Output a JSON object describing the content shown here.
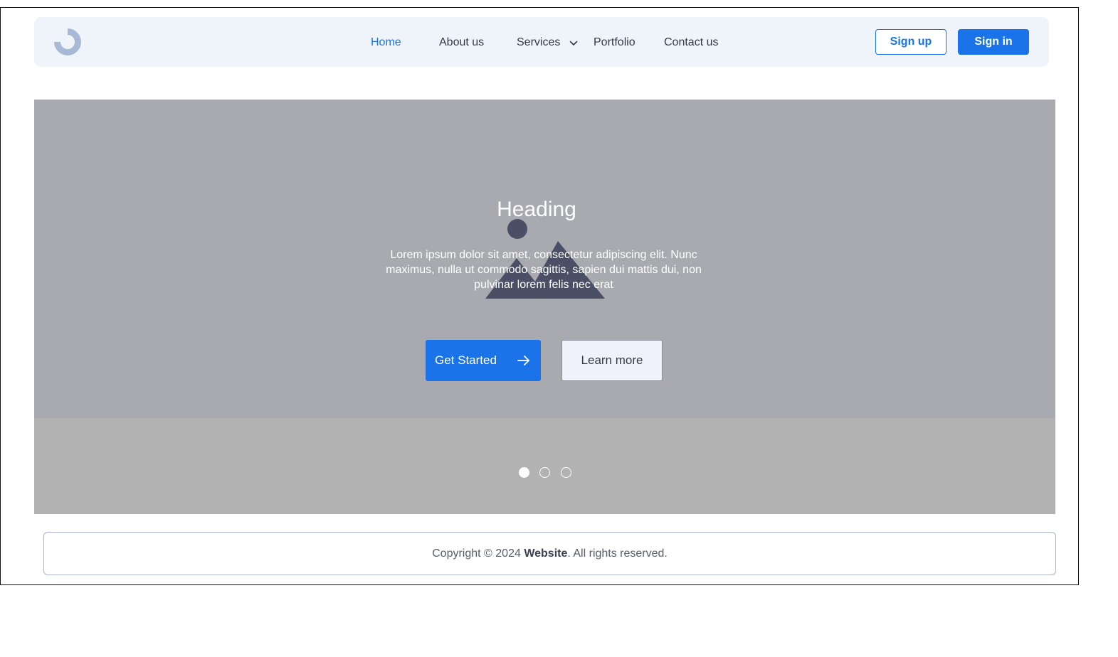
{
  "header": {
    "logo_icon": "logo-ring-icon",
    "nav_items": [
      {
        "label": "Home",
        "active": true
      },
      {
        "label": "About us",
        "active": false
      },
      {
        "label": "Services",
        "active": false,
        "has_dropdown": true
      },
      {
        "label": "Portfolio",
        "active": false
      },
      {
        "label": "Contact us",
        "active": false
      }
    ],
    "signup_label": "Sign up",
    "signin_label": "Sign in"
  },
  "hero": {
    "image_icon": "image-placeholder-icon",
    "heading": "Heading",
    "text": "Lorem ipsum dolor sit amet, consectetur adipiscing elit. Nunc maximus, nulla ut commodo sagittis, sapien dui mattis dui, non pulvinar lorem felis nec erat",
    "primary_button": "Get Started",
    "primary_button_icon": "arrow-right-icon",
    "secondary_button": "Learn more",
    "slides_total": 3,
    "active_slide": 1
  },
  "footer": {
    "prefix": "Copyright © 2024 ",
    "brand": "Website",
    "suffix": ". All rights reserved."
  },
  "colors": {
    "accent": "#1a73e8",
    "nav_bg": "#eff4fb",
    "hero_bg": "#a9aaaf",
    "hero_bottom_bg": "#b2b2b2",
    "placeholder_shape": "#4a4f66"
  }
}
